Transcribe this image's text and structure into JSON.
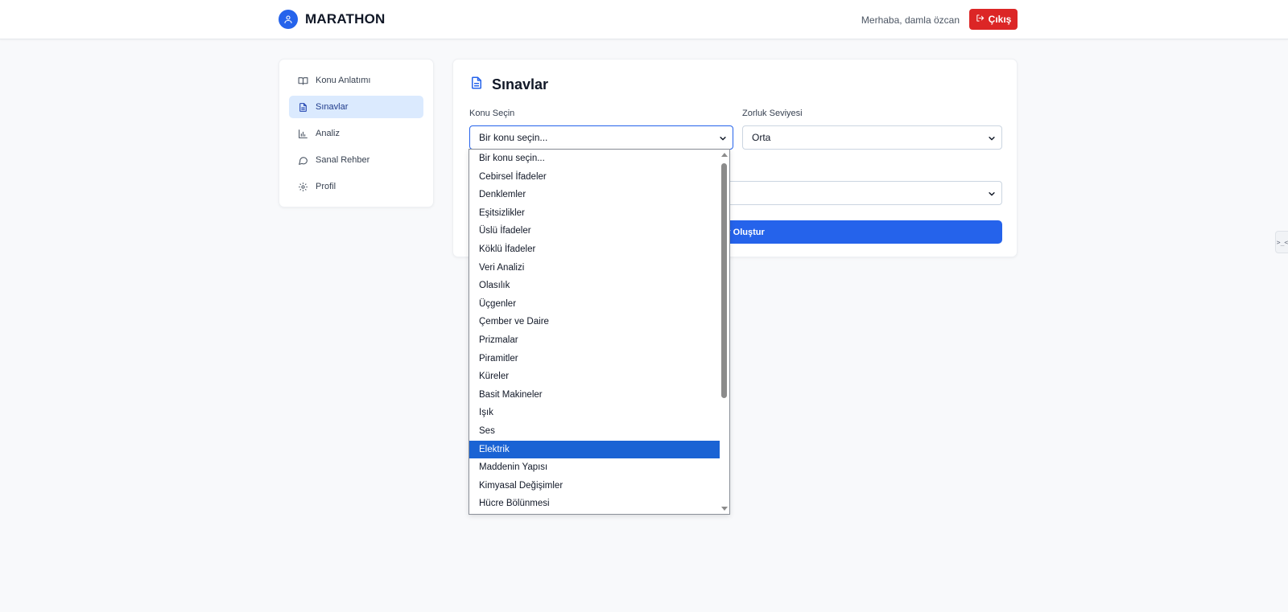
{
  "header": {
    "brand": "MARATHON",
    "greeting": "Merhaba, damla özcan",
    "logout_label": "Çıkış"
  },
  "sidebar": {
    "items": [
      {
        "label": "Konu Anlatımı",
        "icon": "book-open-icon",
        "active": false
      },
      {
        "label": "Sınavlar",
        "icon": "document-icon",
        "active": true
      },
      {
        "label": "Analiz",
        "icon": "bar-chart-icon",
        "active": false
      },
      {
        "label": "Sanal Rehber",
        "icon": "chat-bubble-icon",
        "active": false
      },
      {
        "label": "Profil",
        "icon": "gear-icon",
        "active": false
      }
    ]
  },
  "main": {
    "title": "Sınavlar",
    "title_icon": "document-icon",
    "topic_label": "Konu Seçin",
    "topic_value": "Bir konu seçin...",
    "difficulty_label": "Zorluk Seviyesi",
    "difficulty_value": "Orta",
    "create_button_label": "Sınav Oluştur"
  },
  "topic_dropdown": {
    "options": [
      "Bir konu seçin...",
      "Cebirsel İfadeler",
      "Denklemler",
      "Eşitsizlikler",
      "Üslü İfadeler",
      "Köklü İfadeler",
      "Veri Analizi",
      "Olasılık",
      "Üçgenler",
      "Çember ve Daire",
      "Prizmalar",
      "Piramitler",
      "Küreler",
      "Basit Makineler",
      "Işık",
      "Ses",
      "Elektrik",
      "Maddenin Yapısı",
      "Kimyasal Değişimler",
      "Hücre Bölünmesi"
    ],
    "highlighted": "Elektrik"
  },
  "colors": {
    "primary": "#2563eb",
    "danger": "#dc2626",
    "active_nav_bg": "#dbeafe",
    "highlight": "#1a63d4"
  },
  "edge_tab": {
    "label": ">_<"
  }
}
